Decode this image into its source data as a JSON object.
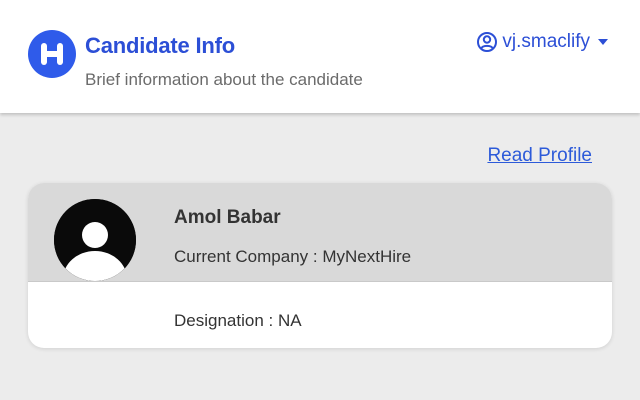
{
  "header": {
    "title": "Candidate Info",
    "subtitle": "Brief information about the candidate",
    "logo_icon": "hirebase-logo-icon",
    "user": {
      "username": "vj.smaclify",
      "icon": "user-icon",
      "dropdown_icon": "caret-down-icon"
    }
  },
  "actions": {
    "read_profile": "Read Profile"
  },
  "candidate": {
    "name": "Amol Babar",
    "company_label": "Current Company : MyNextHire",
    "designation_label": "Designation : NA",
    "avatar_icon": "default-avatar-icon"
  },
  "colors": {
    "brand": "#2f5bea",
    "link": "#2c5ad9",
    "card_header": "#d9d9d9",
    "page_bg": "#ececec"
  }
}
